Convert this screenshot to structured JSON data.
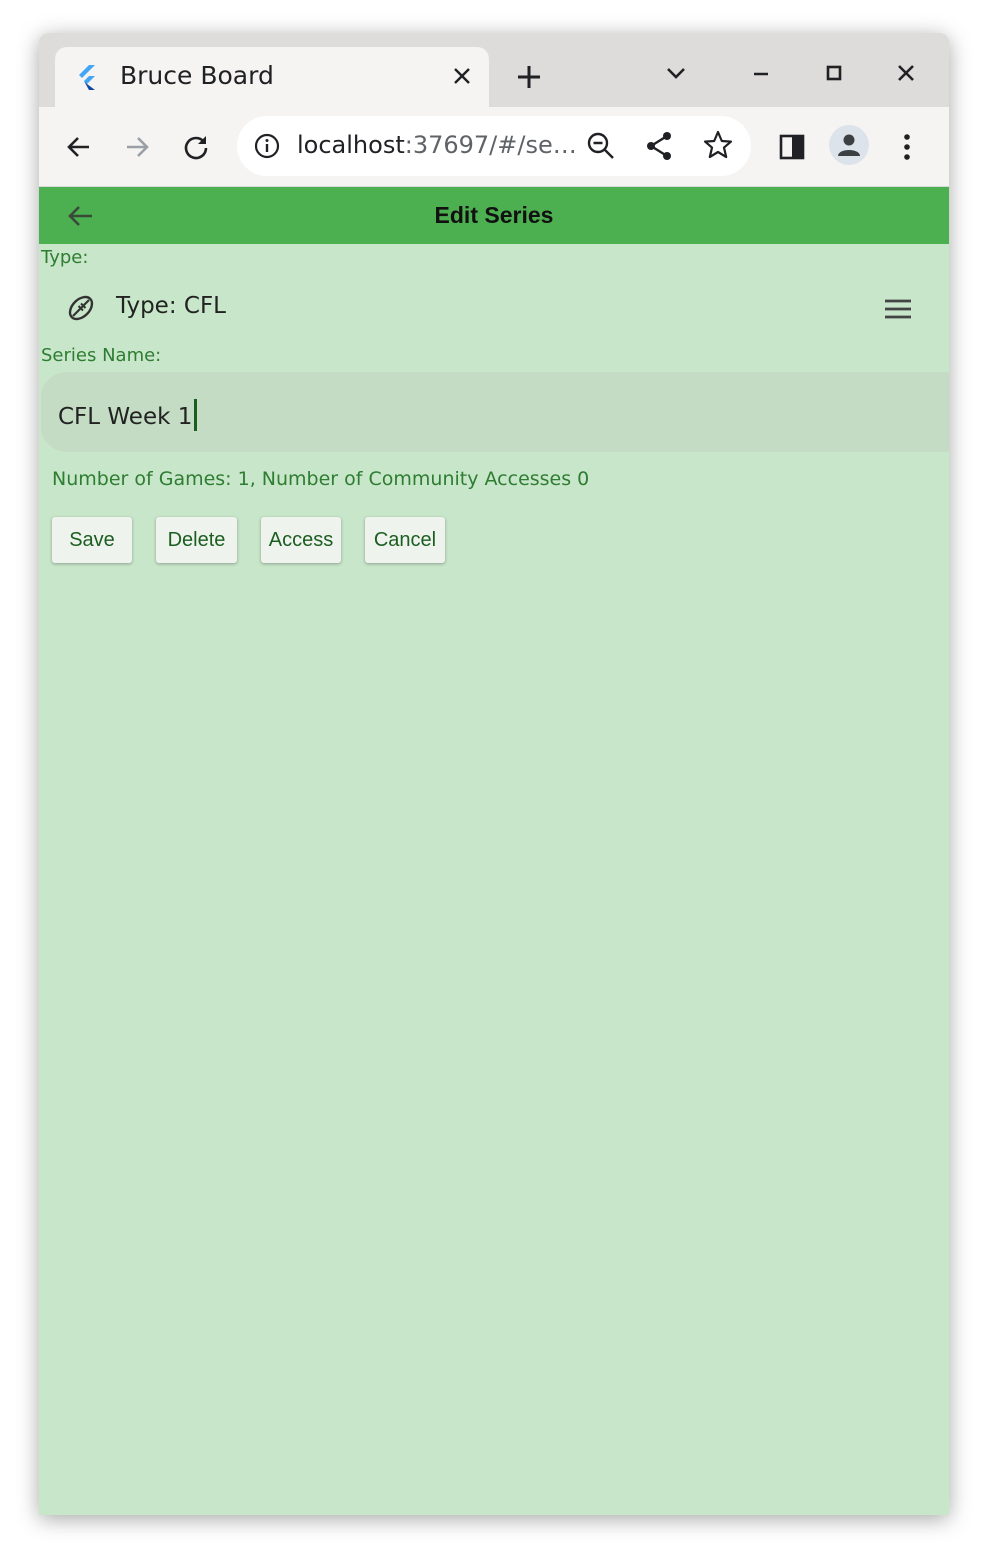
{
  "browser": {
    "tab_title": "Bruce Board",
    "url_host": "localhost",
    "url_rest": ":37697/#/se…"
  },
  "appbar": {
    "title": "Edit Series",
    "color": "#4caf50"
  },
  "form": {
    "type_label": "Type:",
    "type_value": "Type: CFL",
    "series_name_label": "Series Name:",
    "series_name_value": "CFL Week 1",
    "stats": "Number of Games: 1, Number of Community Accesses 0"
  },
  "buttons": {
    "save": "Save",
    "delete": "Delete",
    "access": "Access",
    "cancel": "Cancel"
  },
  "colors": {
    "background": "#c8e6c9",
    "accent_text": "#2e7d32"
  },
  "icons": [
    "flutter-logo-icon",
    "close-icon",
    "plus-icon",
    "chevron-down-icon",
    "minimize-icon",
    "maximize-icon",
    "back-icon",
    "forward-icon",
    "reload-icon",
    "info-icon",
    "zoom-out-icon",
    "share-icon",
    "star-icon",
    "side-panel-icon",
    "profile-icon",
    "more-vert-icon",
    "arrow-back-icon",
    "football-icon",
    "menu-icon"
  ]
}
